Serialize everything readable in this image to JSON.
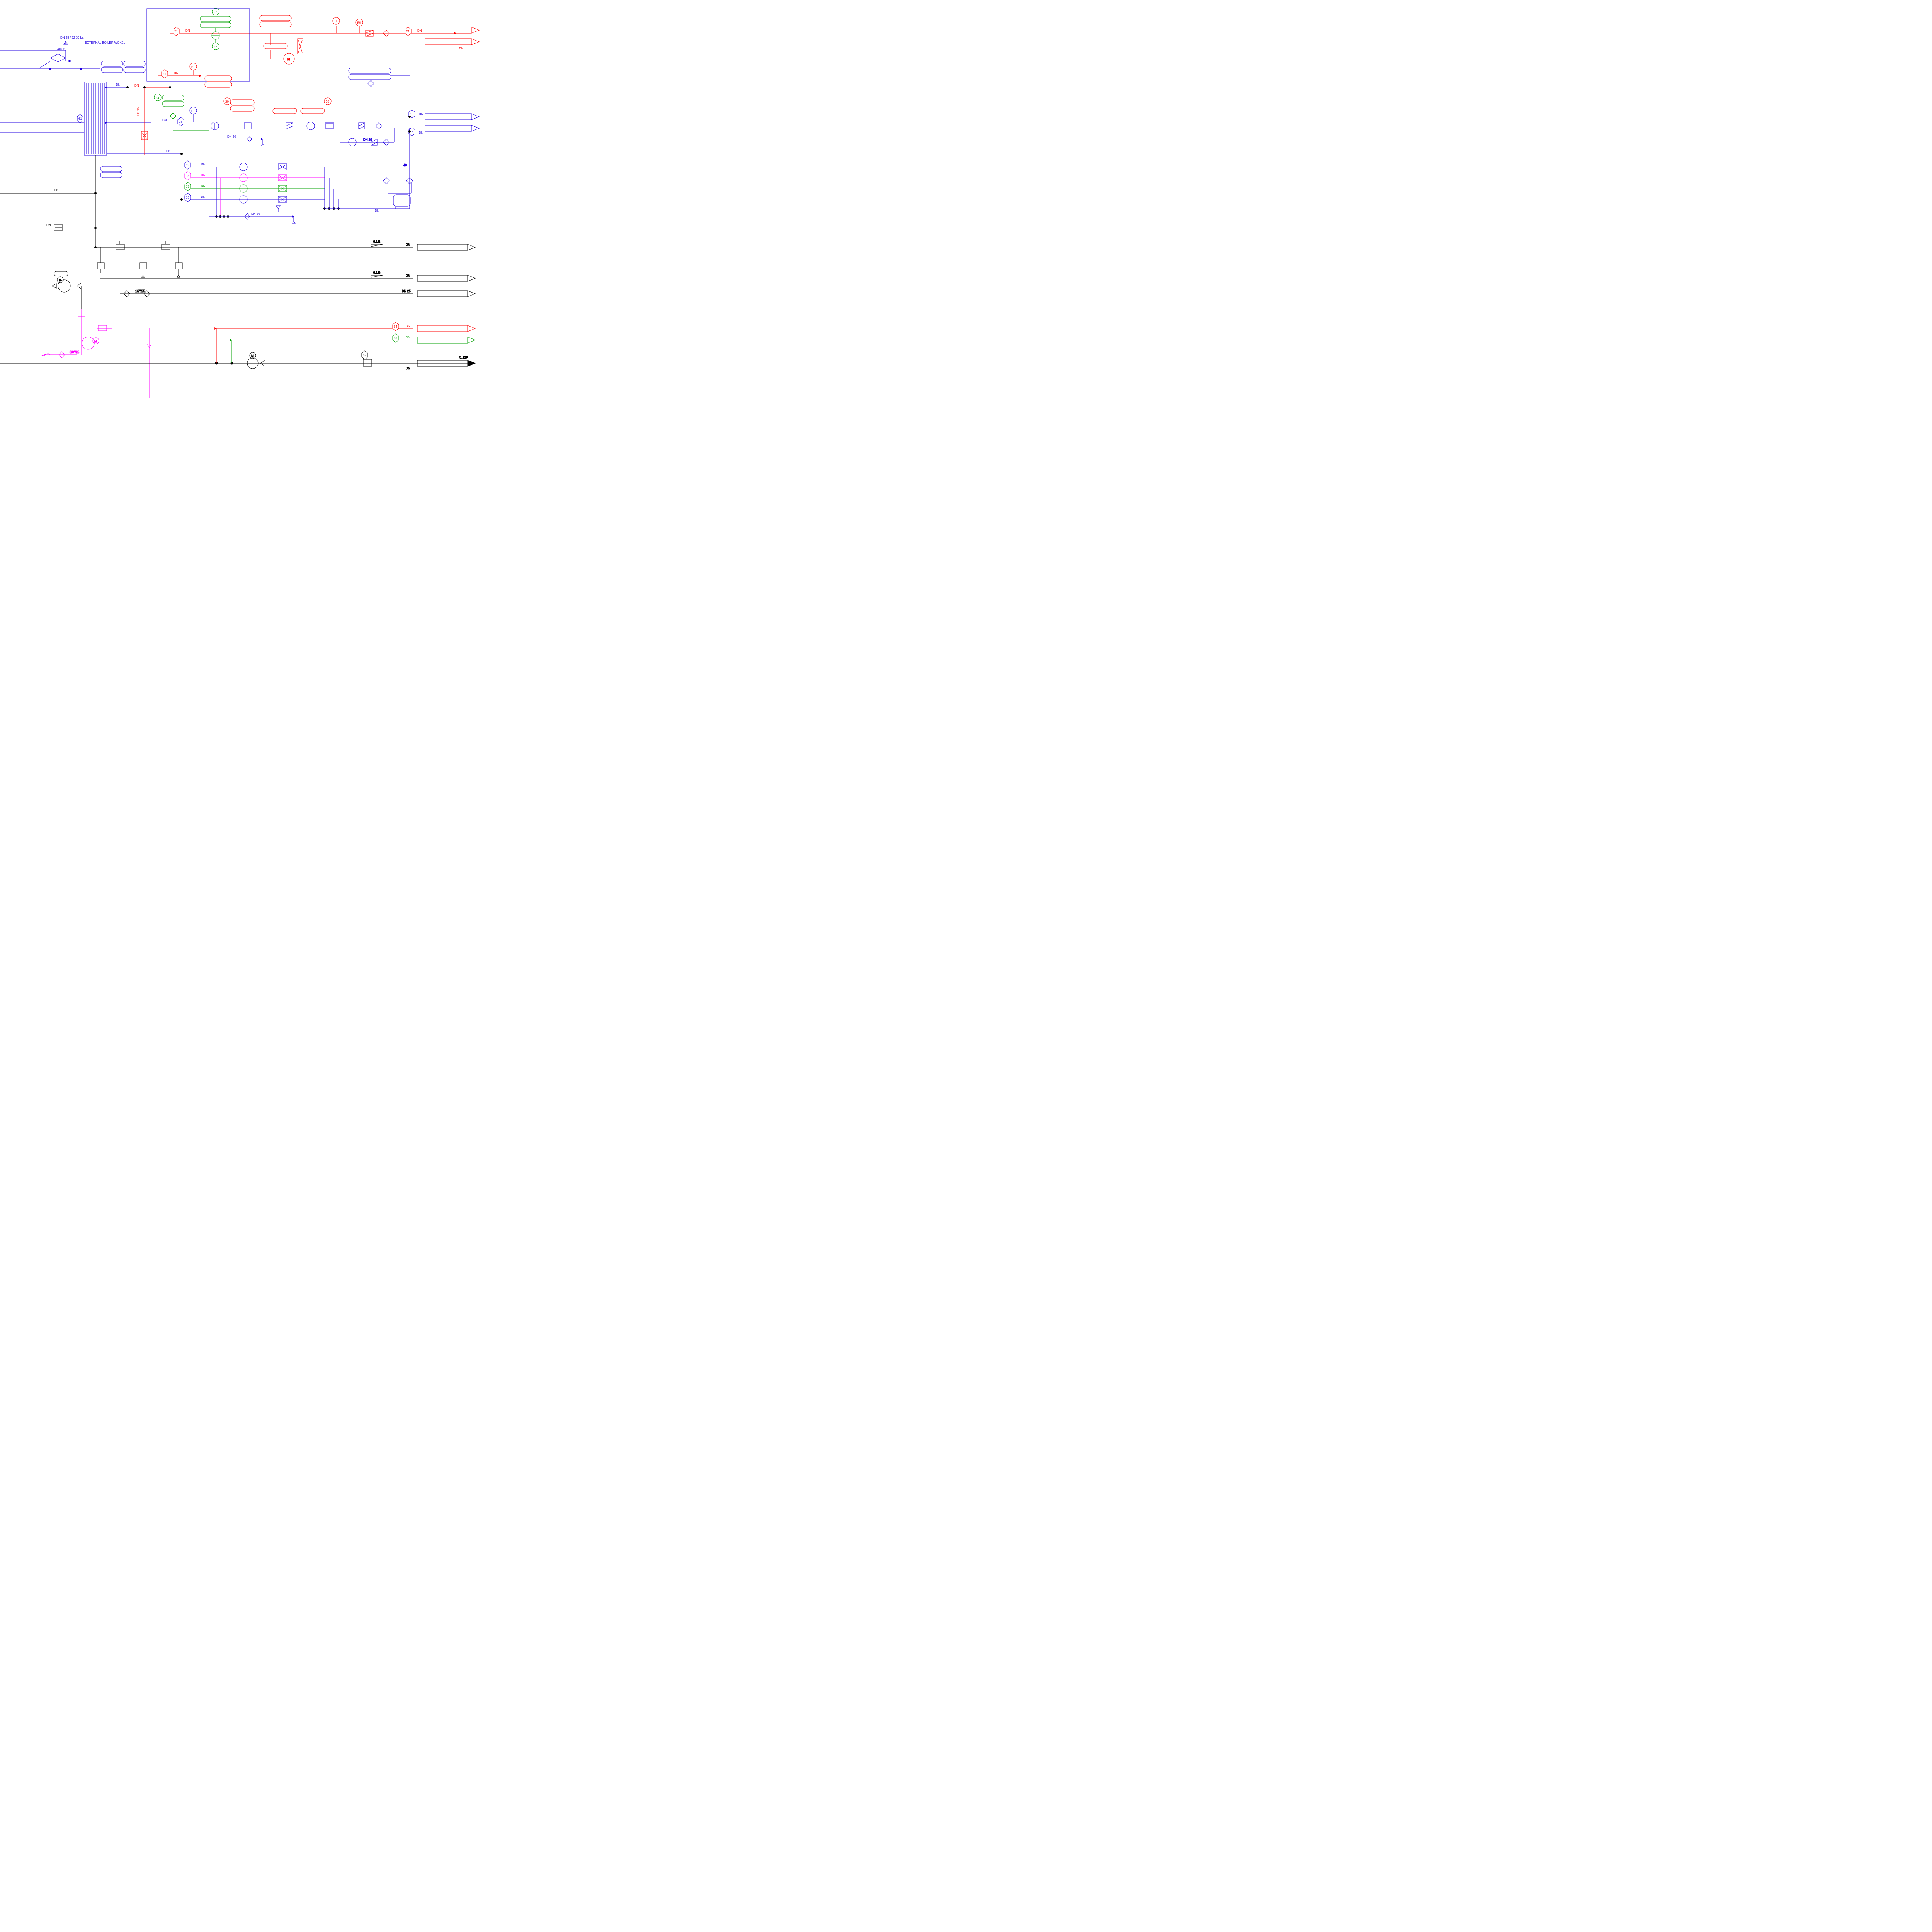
{
  "title": "EXTERNAL BOILER WOK01",
  "spec_label": "DN 25 / 32 36 bar",
  "reducer_40_32": "40/32",
  "dn_15": "DN 15",
  "dn_20_a": "DN 20",
  "dn_20_b": "DN 20",
  "dn_20_c": "DN 20",
  "dn_20_d": "DN 20",
  "dn_25": "DN 25",
  "dn_40": "40",
  "slope_a": "0,1%",
  "slope_b": "0,1%",
  "reducer_half_25": "1/2\"/25",
  "reducer_38_25": "3/8\"/25",
  "sheet_ref": "/1.12F",
  "tags": {
    "t61": "61",
    "t22a": "22",
    "t22b": "22",
    "t21a": "21",
    "t21b": "21",
    "t21c": "21",
    "t24": "24",
    "t20a": "20",
    "t20b": "20",
    "t19": "19",
    "t18": "18",
    "t17": "17",
    "t16a": "16",
    "t16b": "16",
    "t16c": "16",
    "t16d": "16",
    "t54": "54",
    "t53": "53",
    "t52": "52",
    "PI1": "PI",
    "PI2": "PI",
    "PI3": "PI",
    "TI": "TI",
    "M1": "M",
    "M2": "M",
    "M3": "M",
    "M4": "M"
  },
  "dn_labels": [
    "DN",
    "DN",
    "DN",
    "DN",
    "DN",
    "DN",
    "DN",
    "DN",
    "DN",
    "DN",
    "DN",
    "DN",
    "DN",
    "DN",
    "DN",
    "DN",
    "DN",
    "DN",
    "DN",
    "DN"
  ]
}
